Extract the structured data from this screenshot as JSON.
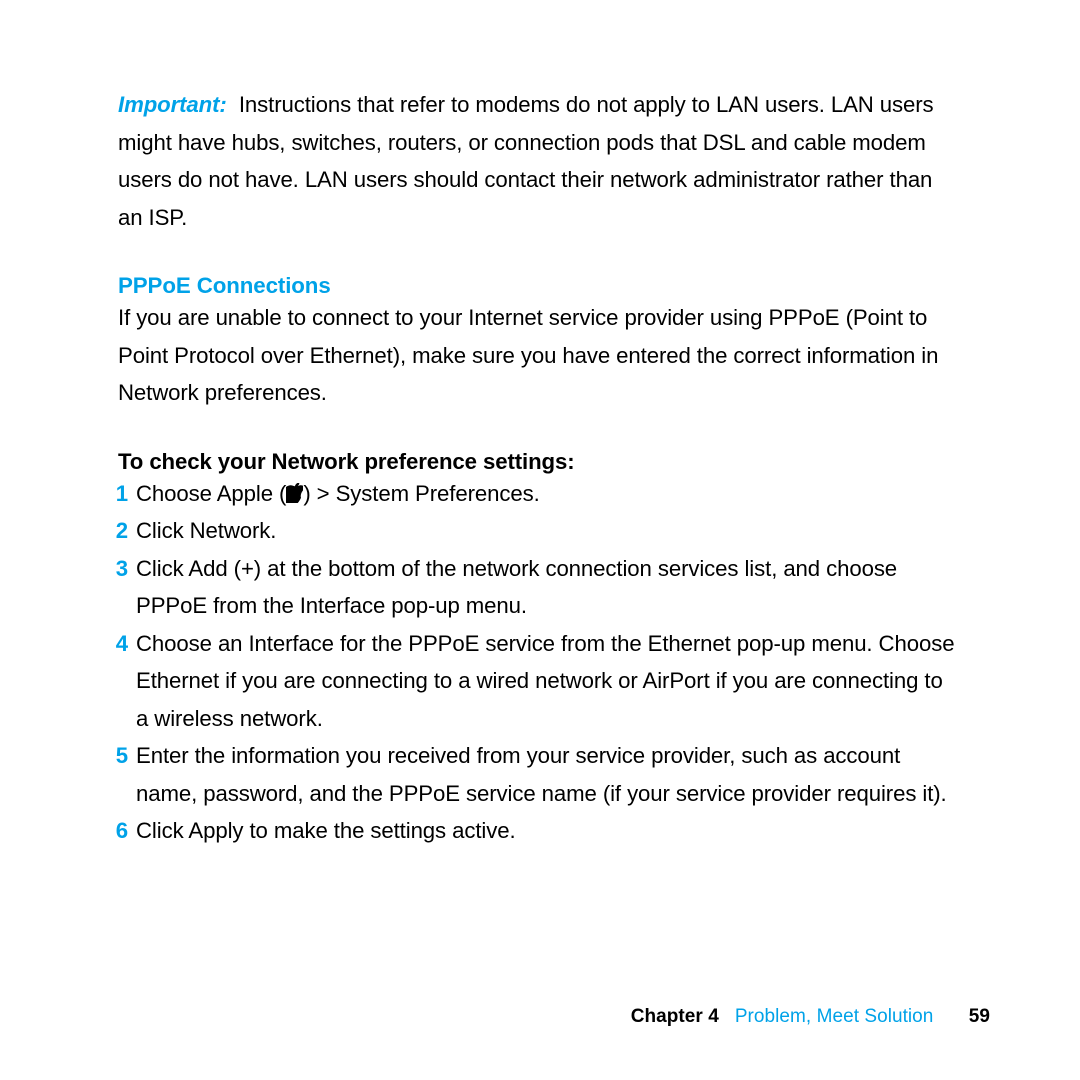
{
  "importantNote": {
    "label": "Important:",
    "text": "  Instructions that refer to modems do not apply to LAN users. LAN users might have hubs, switches, routers, or connection pods that DSL and cable modem users do not have. LAN users should contact their network administrator rather than an ISP."
  },
  "section": {
    "heading": "PPPoE Connections",
    "body": "If you are unable to connect to your Internet service provider using PPPoE (Point to Point Protocol over Ethernet), make sure you have entered the correct information in Network preferences."
  },
  "procedure": {
    "heading": "To check your Network preference settings:",
    "icons": {
      "apple": "apple-logo-icon"
    },
    "steps": [
      {
        "prefix": "Choose Apple (",
        "hasIcon": true,
        "suffix": ") > System Preferences."
      },
      {
        "text": "Click Network."
      },
      {
        "text": "Click Add (+) at the bottom of the network connection services list, and choose PPPoE from the Interface pop-up menu."
      },
      {
        "text": "Choose an Interface for the PPPoE service from the Ethernet pop-up menu. Choose Ethernet if you are connecting to a wired network or AirPort if you are connecting to a wireless network."
      },
      {
        "text": "Enter the information you received from your service provider, such as account name, password, and the PPPoE service name (if your service provider requires it)."
      },
      {
        "text": "Click Apply to make the settings active."
      }
    ]
  },
  "footer": {
    "chapterLabel": "Chapter 4",
    "chapterTitle": "Problem, Meet Solution",
    "pageNumber": "59"
  }
}
